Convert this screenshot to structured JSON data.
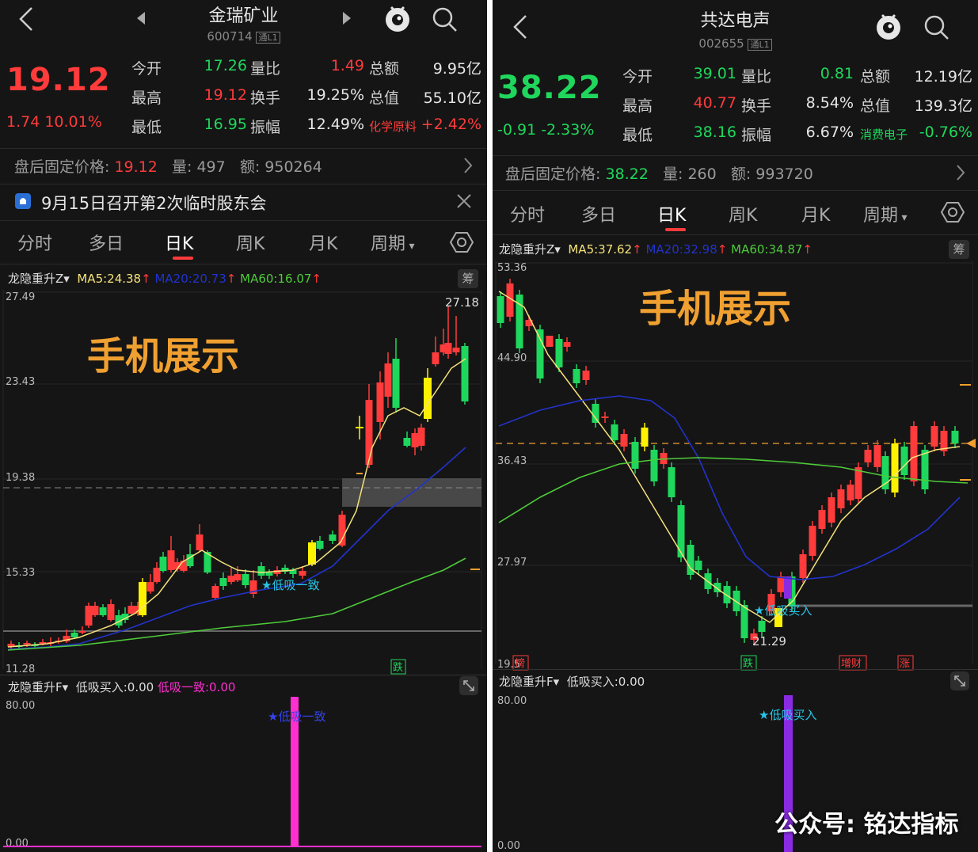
{
  "panels": [
    {
      "title": "金瑞矿业",
      "code": "600714",
      "code_badge": "通L1",
      "price": "19.12",
      "change": "1.74 10.01%",
      "change_color": "#ff3b3b",
      "quote_rows": [
        {
          "l1": "今开",
          "v1": "17.26",
          "c1": "#1fd75c",
          "l2": "量比",
          "v2": "1.49",
          "c2": "#ff3b3b",
          "l3": "总额",
          "v3": "9.95亿"
        },
        {
          "l1": "最高",
          "v1": "19.12",
          "c1": "#ff3b3b",
          "l2": "换手",
          "v2": "19.25%",
          "c2": "#e6e6e6",
          "l3": "总值",
          "v3": "55.10亿"
        },
        {
          "l1": "最低",
          "v1": "16.95",
          "c1": "#1fd75c",
          "l2": "振幅",
          "v2": "12.49%",
          "c2": "#e6e6e6",
          "sector": "化学原料",
          "sector_chg": "+2.42%",
          "sector_color": "#ff3b3b"
        }
      ],
      "after_hours": {
        "label": "盘后固定价格:",
        "price": "19.12",
        "vol_label": "量:",
        "vol": "497",
        "amt_label": "额:",
        "amt": "950264",
        "price_color": "#ff3b3b"
      },
      "notice": "9月15日召开第2次临时股东会",
      "tabs": [
        "分时",
        "多日",
        "日K",
        "周K",
        "月K",
        "周期"
      ],
      "active_tab": 2,
      "indicator": {
        "name": "龙隐重升Z",
        "ma5": "MA5:24.38",
        "ma20": "MA20:20.73",
        "ma60": "MA60:16.07",
        "chip": "筹"
      },
      "y_labels": [
        "27.49",
        "23.43",
        "19.38",
        "15.33",
        "11.28"
      ],
      "max_label": "27.18",
      "overlay_text": "手机展示",
      "signal_text": "★低吸一致",
      "marker_tags": [
        "跌"
      ],
      "sub_indicator": {
        "name": "龙隐重升F",
        "text1": "低吸买入:0.00",
        "text2": "低吸一致:0.00",
        "signal": "★低吸一致",
        "y_top": "80.00",
        "y_bottom": "0.00"
      }
    },
    {
      "title": "共达电声",
      "code": "002655",
      "code_badge": "通L1",
      "price": "38.22",
      "change": "-0.91 -2.33%",
      "change_color": "#1fd75c",
      "quote_rows": [
        {
          "l1": "今开",
          "v1": "39.01",
          "c1": "#1fd75c",
          "l2": "量比",
          "v2": "0.81",
          "c2": "#1fd75c",
          "l3": "总额",
          "v3": "12.19亿"
        },
        {
          "l1": "最高",
          "v1": "40.77",
          "c1": "#ff3b3b",
          "l2": "换手",
          "v2": "8.54%",
          "c2": "#e6e6e6",
          "l3": "总值",
          "v3": "139.3亿"
        },
        {
          "l1": "最低",
          "v1": "38.16",
          "c1": "#1fd75c",
          "l2": "振幅",
          "v2": "6.67%",
          "c2": "#e6e6e6",
          "sector": "消费电子",
          "sector_chg": "-0.76%",
          "sector_color": "#1fd75c"
        }
      ],
      "after_hours": {
        "label": "盘后固定价格:",
        "price": "38.22",
        "vol_label": "量:",
        "vol": "260",
        "amt_label": "额:",
        "amt": "993720",
        "price_color": "#1fd75c"
      },
      "tabs": [
        "分时",
        "多日",
        "日K",
        "周K",
        "月K",
        "周期"
      ],
      "active_tab": 2,
      "indicator": {
        "name": "龙隐重升Z",
        "ma5": "MA5:37.62",
        "ma20": "MA20:32.98",
        "ma60": "MA60:34.87",
        "chip": "筹"
      },
      "y_labels": [
        "53.36",
        "44.90",
        "36.43",
        "27.97",
        "19.5"
      ],
      "min_label": "21.29",
      "overlay_text": "手机展示",
      "signal_text": "★低吸买入",
      "marker_tags": [
        "榜",
        "跌",
        "增财",
        "涨"
      ],
      "sub_indicator": {
        "name": "龙隐重升F",
        "text1": "低吸买入:0.00",
        "signal": "★低吸买入",
        "y_top": "80.00",
        "y_bottom": "0.00"
      }
    }
  ],
  "footer": "公众号: 铭达指标",
  "colors": {
    "up": "#ff3b3b",
    "down": "#1fd75c",
    "ma5": "#f5e27a",
    "ma20": "#2233cc",
    "ma60": "#4ecb3a",
    "signal0": "#ff2fd0",
    "signal1": "#8a2be2",
    "accent": "#f0a030"
  }
}
